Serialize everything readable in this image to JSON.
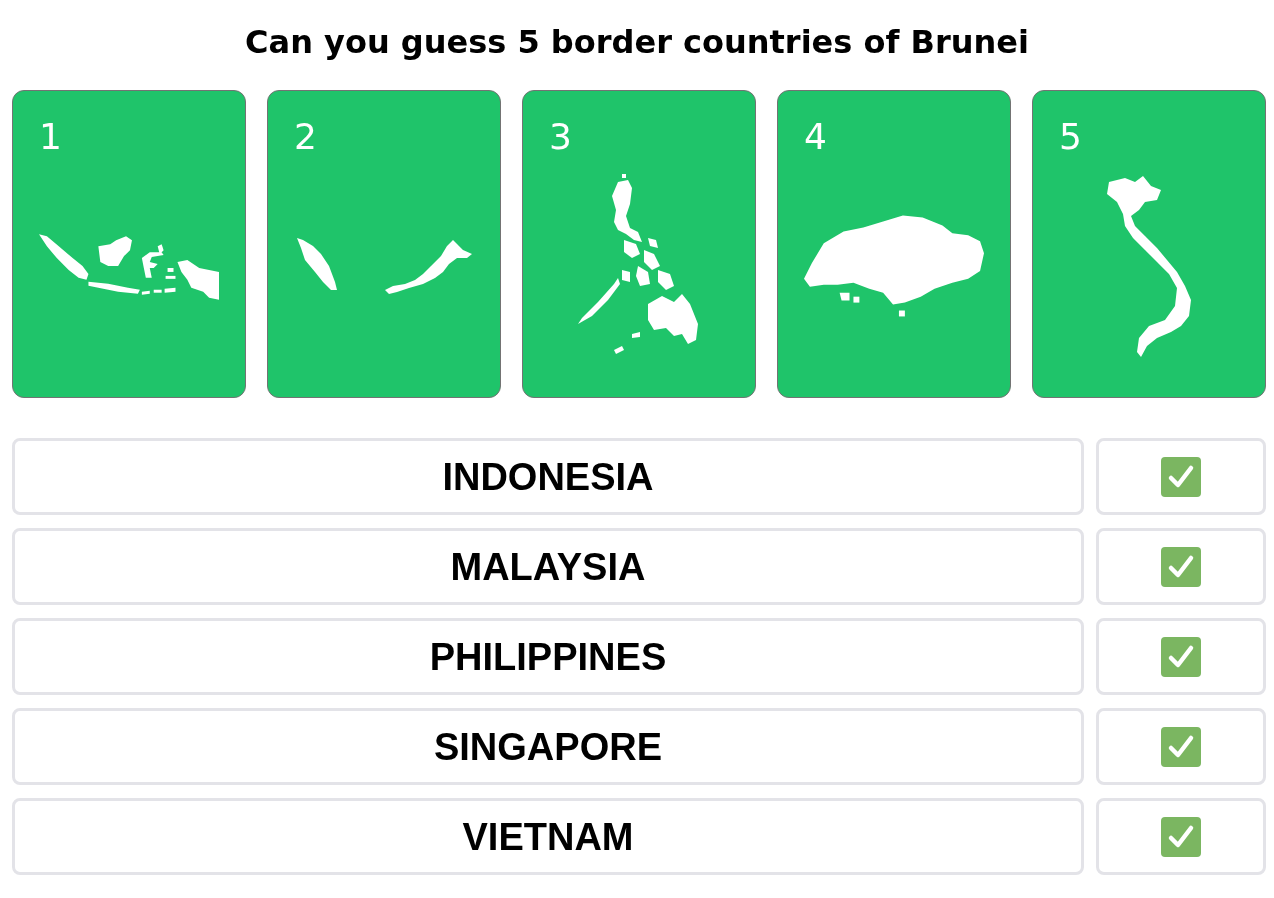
{
  "title": "Can you guess 5 border countries of Brunei",
  "cards": [
    {
      "number": "1"
    },
    {
      "number": "2"
    },
    {
      "number": "3"
    },
    {
      "number": "4"
    },
    {
      "number": "5"
    }
  ],
  "answers": [
    {
      "name": "INDONESIA",
      "correct": true
    },
    {
      "name": "MALAYSIA",
      "correct": true
    },
    {
      "name": "PHILIPPINES",
      "correct": true
    },
    {
      "name": "SINGAPORE",
      "correct": true
    },
    {
      "name": "VIETNAM",
      "correct": true
    }
  ]
}
